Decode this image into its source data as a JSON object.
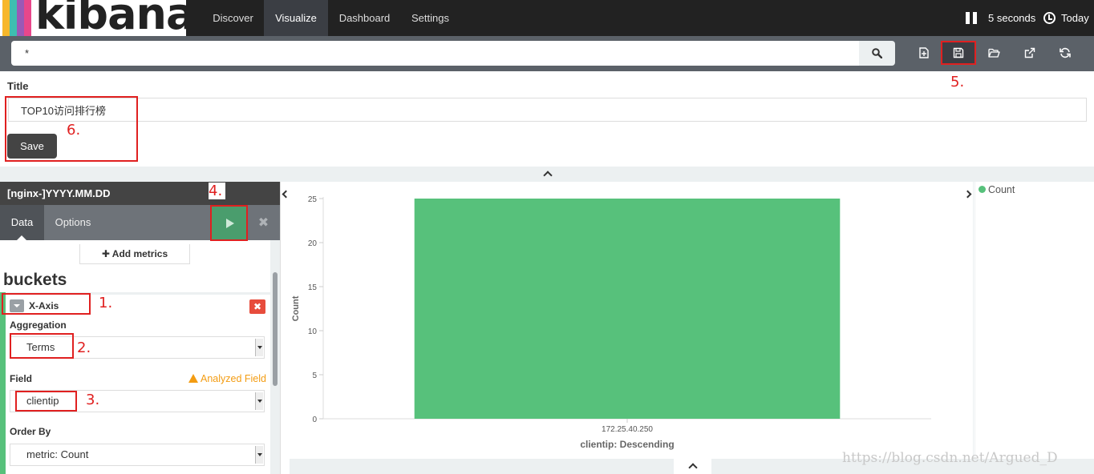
{
  "nav": {
    "logo_text": "kibana",
    "logo_stripe_colors": [
      "#f7b72b",
      "#3ebeb0",
      "#9b59b6",
      "#e8478b"
    ],
    "tabs": [
      {
        "label": "Discover",
        "active": false
      },
      {
        "label": "Visualize",
        "active": true
      },
      {
        "label": "Dashboard",
        "active": false
      },
      {
        "label": "Settings",
        "active": false
      }
    ],
    "refresh_interval": "5 seconds",
    "time_range": "Today"
  },
  "search": {
    "query": "*",
    "button_icon": "search-icon"
  },
  "toolbar": {
    "icons": [
      "new-visualization-icon",
      "save-icon",
      "open-folder-icon",
      "share-icon",
      "refresh-icon"
    ]
  },
  "save_panel": {
    "title_label": "Title",
    "title_value": "TOP10访问排行榜",
    "save_label": "Save"
  },
  "sidebar": {
    "index_pattern": "[nginx-]YYYY.MM.DD",
    "tabs": [
      {
        "label": "Data",
        "active": true
      },
      {
        "label": "Options",
        "active": false
      }
    ],
    "apply_icon": "play-icon",
    "discard_icon": "close-icon",
    "add_metrics_label": "Add metrics",
    "buckets_title": "buckets",
    "bucket": {
      "name": "X-Axis",
      "aggregation_label": "Aggregation",
      "aggregation_value": "Terms",
      "field_label": "Field",
      "field_warning": "Analyzed Field",
      "field_value": "clientip",
      "order_by_label": "Order By",
      "order_by_value": "metric: Count"
    }
  },
  "chart_data": {
    "type": "bar",
    "categories": [
      "172.25.40.250"
    ],
    "series": [
      {
        "name": "Count",
        "values": [
          25
        ],
        "color": "#57c17b"
      }
    ],
    "xlabel": "clientip: Descending",
    "ylabel": "Count",
    "ylim": [
      0,
      25
    ],
    "yticks": [
      0,
      5,
      10,
      15,
      20,
      25
    ],
    "grid": false,
    "legend": {
      "position": "right",
      "entries": [
        "Count"
      ]
    }
  },
  "annotations": [
    "1.",
    "2.",
    "3.",
    "4.",
    "5.",
    "6."
  ],
  "watermark": "https://blog.csdn.net/Argued_D"
}
